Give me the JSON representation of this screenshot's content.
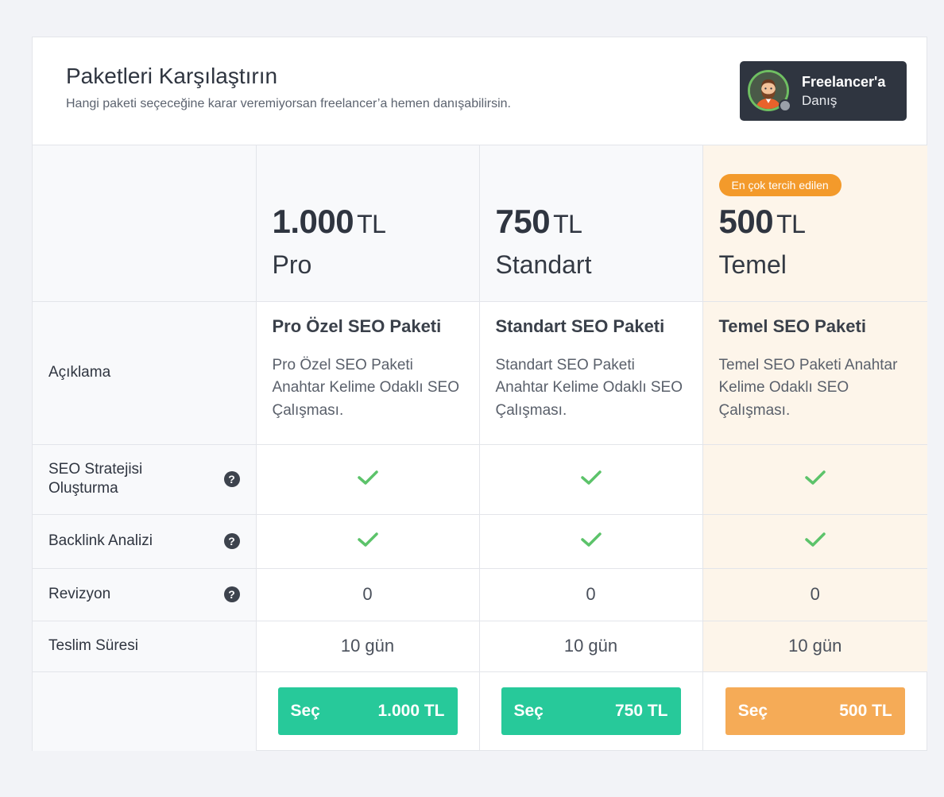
{
  "header": {
    "title": "Paketleri Karşılaştırın",
    "subtitle": "Hangi paketi seçeceğine karar veremiyorsan freelancer’a hemen danışabilirsin.",
    "consult_title": "Freelancer'a",
    "consult_sub": "Danış"
  },
  "badge": "En çok tercih edilen",
  "currency": "TL",
  "plans": [
    {
      "price": "1.000",
      "name": "Pro",
      "desc_title": "Pro Özel SEO Paketi",
      "desc_text": "Pro Özel SEO Paketi Anahtar Kelime Odaklı SEO Çalışması.",
      "revision": "0",
      "delivery": "10 gün",
      "button_label": "Seç",
      "button_price": "1.000 TL"
    },
    {
      "price": "750",
      "name": "Standart",
      "desc_title": "Standart SEO Paketi",
      "desc_text": "Standart SEO Paketi Anahtar Kelime Odaklı SEO Çalışması.",
      "revision": "0",
      "delivery": "10 gün",
      "button_label": "Seç",
      "button_price": "750 TL"
    },
    {
      "price": "500",
      "name": "Temel",
      "desc_title": "Temel SEO Paketi",
      "desc_text": "Temel SEO Paketi Anahtar Kelime Odaklı SEO Çalışması.",
      "revision": "0",
      "delivery": "10 gün",
      "button_label": "Seç",
      "button_price": "500 TL"
    }
  ],
  "rows": {
    "description": "Açıklama",
    "seo_strategy": "SEO Stratejisi Oluşturma",
    "backlink": "Backlink Analizi",
    "revision": "Revizyon",
    "delivery": "Teslim Süresi"
  },
  "help_glyph": "?",
  "colors": {
    "accent_green": "#27c99a",
    "accent_orange": "#f5ab57",
    "badge_orange": "#f39a2b",
    "check_green": "#5cc36a",
    "highlight_bg": "#fdf5ea"
  },
  "icons": {
    "check": "check-icon",
    "help": "help-icon",
    "avatar": "freelancer-avatar"
  }
}
